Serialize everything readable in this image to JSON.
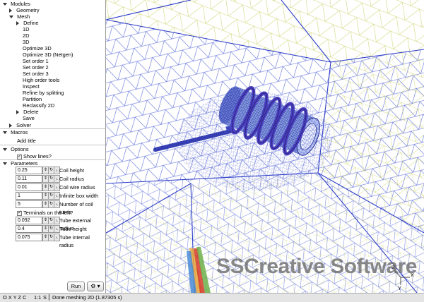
{
  "tree": {
    "modules": "Modules",
    "geometry": "Geometry",
    "mesh": "Mesh",
    "mesh_items": [
      "Define",
      "1D",
      "2D",
      "3D",
      "Optimize 3D",
      "Optimize 3D (Netgen)",
      "Set order 1",
      "Set order 2",
      "Set order 3",
      "High order tools",
      "Inspect",
      "Refine by splitting",
      "Partition",
      "Reclassify 2D",
      "Delete",
      "Save"
    ],
    "solver": "Solver",
    "macros": "Macros",
    "add_title": "Add title",
    "options": "Options",
    "show_lines": "Show lines?",
    "parameters": "Parameters"
  },
  "parameters": [
    {
      "value": "0.25",
      "label": "Coil height"
    },
    {
      "value": "0.11",
      "label": "Coil radius"
    },
    {
      "value": "0.01",
      "label": "Coil wire radius"
    },
    {
      "value": "1",
      "label": "Infinite box width"
    },
    {
      "value": "5",
      "label": "Number of coil turns"
    }
  ],
  "terminals_label": "Terminals on the left?",
  "parameters2": [
    {
      "value": "0.092",
      "label": "Tube external radius"
    },
    {
      "value": "0.4",
      "label": "Tube height"
    },
    {
      "value": "0.075",
      "label": "Tube internal radius"
    }
  ],
  "run_label": "Run",
  "gear_label": "⚙ ▾",
  "status": {
    "view_buttons": "O X Y Z C",
    "scale": "1:1",
    "s": "S",
    "message": "Done meshing 2D (1.87305 s)"
  },
  "watermark": "SSCreative Software",
  "axes": {
    "x": "X",
    "y": "Y",
    "z": "Z"
  },
  "colors": {
    "mesh_blue": "#3a4fd0",
    "mesh_yellow": "#cdd36a",
    "coil_purple": "#4a3fc0"
  }
}
